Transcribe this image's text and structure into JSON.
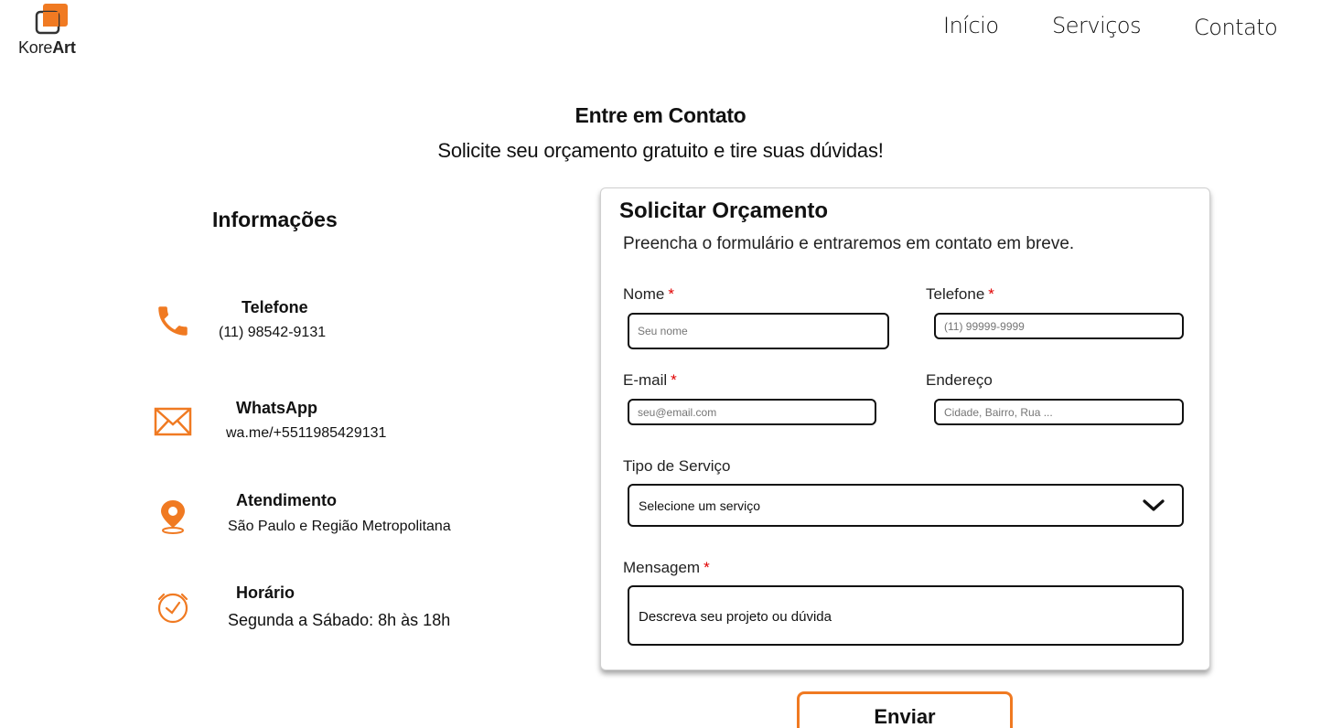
{
  "brand": {
    "name_regular": "Kore",
    "name_bold": "Art",
    "accent": "#f07a22"
  },
  "nav": {
    "inicio": "Início",
    "servicos": "Serviços",
    "contato": "Contato"
  },
  "hero": {
    "title": "Entre em Contato",
    "subtitle": "Solicite seu orçamento gratuito e tire suas dúvidas!"
  },
  "info": {
    "heading": "Informações",
    "items": [
      {
        "icon": "phone-icon",
        "title": "Telefone",
        "value": "(11) 98542-9131"
      },
      {
        "icon": "mail-icon",
        "title": "WhatsApp",
        "value": "wa.me/+5511985429131"
      },
      {
        "icon": "location-pin-icon",
        "title": "Atendimento",
        "value": "São Paulo e Região Metropolitana"
      },
      {
        "icon": "clock-icon",
        "title": "Horário",
        "value": "Segunda a Sábado: 8h às 18h"
      }
    ]
  },
  "form": {
    "title": "Solicitar Orçamento",
    "subtitle": "Preencha o formulário e entraremos em contato em breve.",
    "required_mark": "*",
    "nome": {
      "label": "Nome",
      "placeholder": "Seu nome"
    },
    "telefone": {
      "label": "Telefone",
      "placeholder": "(11) 99999-9999"
    },
    "email": {
      "label": "E-mail",
      "placeholder": "seu@email.com"
    },
    "endereco": {
      "label": "Endereço",
      "placeholder": "Cidade, Bairro, Rua ..."
    },
    "servico": {
      "label": "Tipo de Serviço",
      "selected": "Selecione um serviço"
    },
    "mensagem": {
      "label": "Mensagem",
      "placeholder": "Descreva seu projeto ou dúvida"
    },
    "submit": "Enviar"
  }
}
